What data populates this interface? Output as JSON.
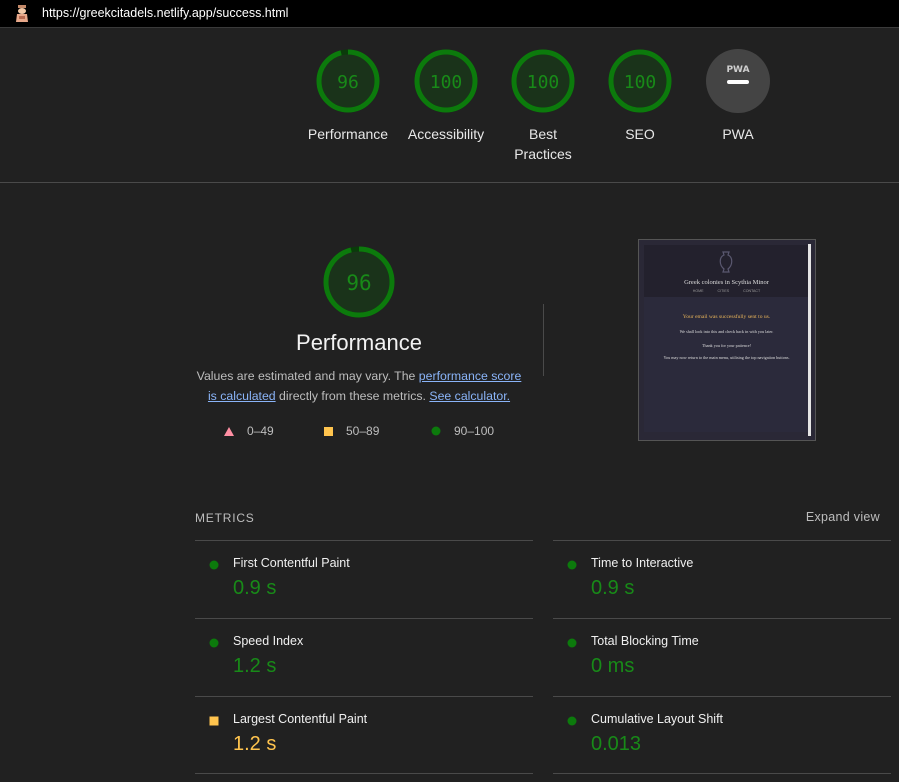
{
  "browser": {
    "url": "https://greekcitadels.netlify.app/success.html"
  },
  "colors": {
    "pass": "#0c7a0c",
    "pass_text": "#188a18",
    "average": "#ffc44e",
    "fail": "#ff6f85",
    "pwa_bg": "#444444"
  },
  "top_gauges": [
    {
      "label": "Performance",
      "score": "96",
      "score_fraction": 0.96
    },
    {
      "label": "Accessibility",
      "score": "100",
      "score_fraction": 1.0
    },
    {
      "label": "Best Practices",
      "score": "100",
      "score_fraction": 1.0
    },
    {
      "label": "SEO",
      "score": "100",
      "score_fraction": 1.0
    },
    {
      "label": "PWA",
      "badge": "PWA"
    }
  ],
  "performance": {
    "score": "96",
    "score_fraction": 0.96,
    "title": "Performance",
    "desc_prefix": "Values are estimated and may vary. The ",
    "link1": "performance score is calculated",
    "desc_middle": " directly from these metrics. ",
    "link2": "See calculator."
  },
  "legend": [
    {
      "icon": "triangle-fail-icon",
      "range": "0–49"
    },
    {
      "icon": "square-average-icon",
      "range": "50–89"
    },
    {
      "icon": "circle-pass-icon",
      "range": "90–100"
    }
  ],
  "screenshot": {
    "site_title": "Greek colonies in Scythia Minor",
    "nav": [
      "HOME",
      "CITIES",
      "CONTACT"
    ],
    "success": "Your email was successfully sent to us.",
    "line1": "We shall look into this and check back in with you later.",
    "line2": "Thank you for your patience!",
    "line3": "You may now return to the main menu, utilising the top navigation buttons."
  },
  "metrics": {
    "heading": "METRICS",
    "expand_label": "Expand view",
    "items": [
      {
        "name": "First Contentful Paint",
        "value": "0.9 s",
        "rating": "pass"
      },
      {
        "name": "Time to Interactive",
        "value": "0.9 s",
        "rating": "pass"
      },
      {
        "name": "Speed Index",
        "value": "1.2 s",
        "rating": "pass"
      },
      {
        "name": "Total Blocking Time",
        "value": "0 ms",
        "rating": "pass"
      },
      {
        "name": "Largest Contentful Paint",
        "value": "1.2 s",
        "rating": "average"
      },
      {
        "name": "Cumulative Layout Shift",
        "value": "0.013",
        "rating": "pass"
      }
    ]
  }
}
